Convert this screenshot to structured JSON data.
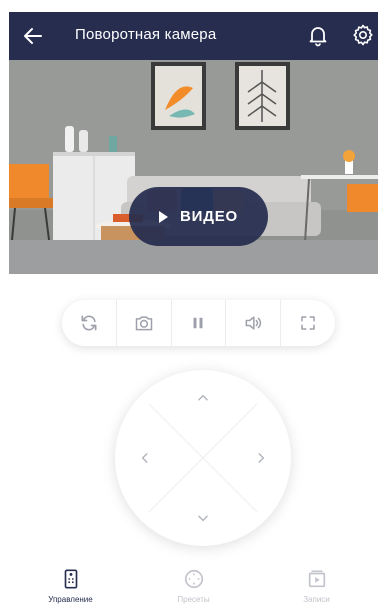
{
  "header": {
    "title": "Поворотная камера",
    "back_icon": "arrow-left-icon",
    "notifications_icon": "bell-icon",
    "settings_icon": "gear-icon"
  },
  "video": {
    "button_label": "ВИДЕО",
    "play_icon": "play-icon"
  },
  "toolbar": {
    "items": [
      {
        "icon": "rotate-icon"
      },
      {
        "icon": "camera-icon"
      },
      {
        "icon": "pause-icon"
      },
      {
        "icon": "volume-icon"
      },
      {
        "icon": "fullscreen-icon"
      }
    ]
  },
  "joystick": {
    "directions": [
      "up",
      "left",
      "right",
      "down"
    ]
  },
  "bottom_nav": {
    "items": [
      {
        "label": "Управление",
        "icon": "remote-icon",
        "active": true
      },
      {
        "label": "Пресеты",
        "icon": "presets-icon",
        "active": false
      },
      {
        "label": "Записи",
        "icon": "recordings-icon",
        "active": false
      }
    ]
  },
  "colors": {
    "header_bg": "#262d4f",
    "accent": "#262d4f",
    "inactive_icon": "#c2c4cb",
    "background": "#ffffff"
  }
}
